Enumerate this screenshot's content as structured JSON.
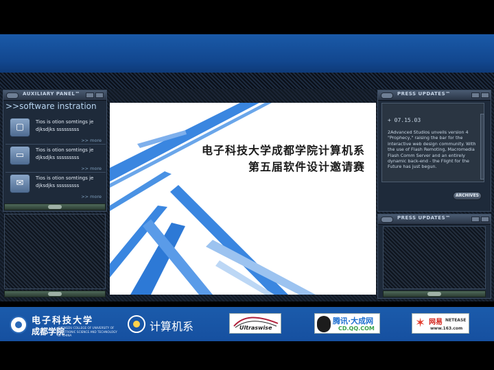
{
  "aux_panel": {
    "title": "AUXILIARY PANEL™",
    "heading": ">>software instration",
    "items": [
      {
        "icon": "shirt-icon",
        "text": "Tios is otion somtings je djksdjks sssssssss",
        "more": ">> more"
      },
      {
        "icon": "monitor-icon",
        "text": "Tios is otion somtings je djksdjks sssssssss",
        "more": ">> more"
      },
      {
        "icon": "mail-icon",
        "text": "Tios is otion somtings je djksdjks sssssssss",
        "more": ">> more"
      }
    ]
  },
  "slide": {
    "title_line1": "电子科技大学成都学院计算机系",
    "title_line2": "第五届软件设计邀请赛"
  },
  "press_panel": {
    "title": "PRESS UPDATES™",
    "date": "+ 07.15.03",
    "text": "2Advanced Studios unveils version 4 \"Prophecy,\" raising the bar for the interactive web design community. With the use of Flash Remoting, Macromedia Flash Comm Server and an entirely dynamic back-end - the Flight for the Future has just begun.",
    "archives_label": "ARCHIVES"
  },
  "press_panel_2": {
    "title": "PRESS UPDATES™"
  },
  "footer": {
    "uestc_name": "电子科技大学",
    "uestc_campus": "成都学院",
    "uestc_english": "CHENGDU COLLEGE OF UNIVERSITY OF ELECTRONIC SCIENCE AND TECHNOLOGY OF CHINA",
    "dept_label": "计算机系",
    "sponsor_ultra": "Ultraswise",
    "sponsor_tencent": "腾讯·大成网",
    "sponsor_tencent_url": "CD.QQ.COM",
    "sponsor_netease": "网易",
    "sponsor_netease_brand": "NETEASE",
    "sponsor_netease_url": "www.163.com"
  },
  "colors": {
    "header_blue": "#1a5aa8",
    "accent_text": "#b7d4f0",
    "slide_stripe": "#3a86e0"
  }
}
